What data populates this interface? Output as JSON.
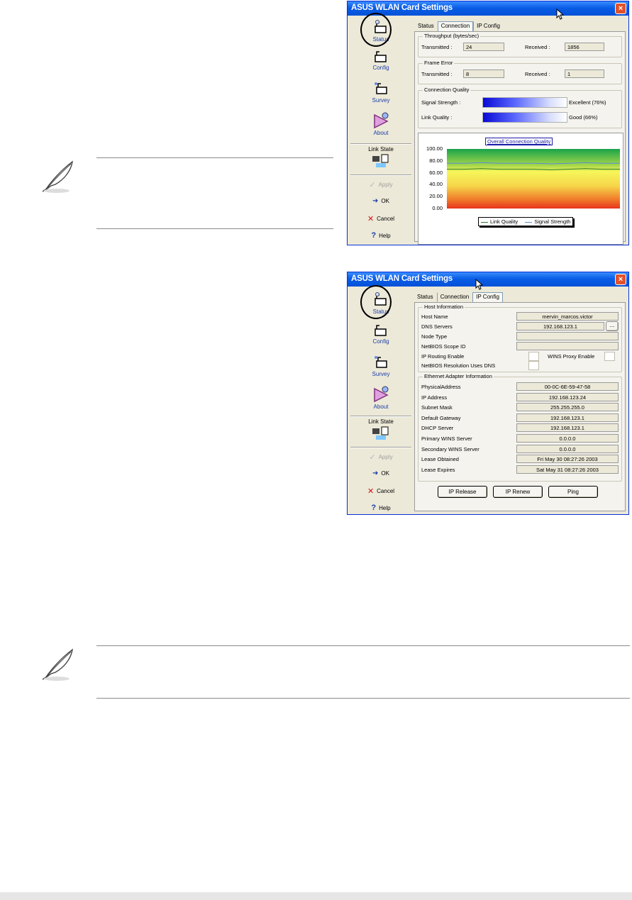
{
  "window_top": {
    "title": "ASUS WLAN Card Settings",
    "close": "×",
    "sidebar": {
      "items": [
        {
          "label": "Status",
          "icon": "status-icon"
        },
        {
          "label": "Config",
          "icon": "config-icon"
        },
        {
          "label": "Survey",
          "icon": "survey-icon"
        },
        {
          "label": "About",
          "icon": "about-icon"
        }
      ],
      "link_state_label": "Link State",
      "actions": [
        {
          "label": "Apply",
          "icon": "checkmark-icon",
          "enabled": false
        },
        {
          "label": "OK",
          "icon": "ok-icon",
          "enabled": true
        },
        {
          "label": "Cancel",
          "icon": "x-icon",
          "enabled": true
        },
        {
          "label": "Help",
          "icon": "question-icon",
          "enabled": true
        }
      ]
    },
    "tabs": [
      {
        "label": "Status",
        "active": false
      },
      {
        "label": "Connection",
        "active": true
      },
      {
        "label": "IP Config",
        "active": false
      }
    ],
    "throughput": {
      "title": "Throughput (bytes/sec)",
      "transmitted_label": "Transmitted :",
      "transmitted_value": "24",
      "received_label": "Received :",
      "received_value": "1856"
    },
    "frame_error": {
      "title": "Frame Error",
      "transmitted_label": "Transmitted :",
      "transmitted_value": "8",
      "received_label": "Received :",
      "received_value": "1"
    },
    "connection_quality": {
      "title": "Connection Quality",
      "signal_label": "Signal Strength :",
      "signal_text": "Excellent (76%)",
      "signal_level": 0.76,
      "link_label": "Link Quality :",
      "link_text": "Good (66%)",
      "link_level": 0.66
    }
  },
  "chart_data": {
    "type": "line",
    "title": "Overall Connection Quality",
    "ylim": [
      0,
      100
    ],
    "yticks": [
      "100.00",
      "80.00",
      "60.00",
      "40.00",
      "20.00",
      "0.00"
    ],
    "series": [
      {
        "name": "Link Quality",
        "color": "#2a7a2a",
        "values": [
          66,
          66,
          67,
          66,
          66,
          66,
          65,
          66,
          67,
          66,
          66
        ]
      },
      {
        "name": "Signal Strength",
        "color": "#5a8ad6",
        "values": [
          76,
          76,
          77,
          76,
          76,
          76,
          75,
          76,
          77,
          76,
          76
        ]
      }
    ],
    "legend_position": "bottom"
  },
  "window_bottom": {
    "title": "ASUS WLAN Card Settings",
    "close": "×",
    "tabs": [
      {
        "label": "Status",
        "active": false
      },
      {
        "label": "Connection",
        "active": false
      },
      {
        "label": "IP Config",
        "active": true
      }
    ],
    "host_info": {
      "title": "Host Information",
      "host_name_label": "Host Name",
      "host_name_value": "mervin_marcos.victor",
      "dns_label": "DNS Servers",
      "dns_value": "192.168.123.1",
      "dns_more": "...",
      "node_type_label": "Node Type",
      "node_type_value": "",
      "netbios_scope_label": "NetBIOS Scope ID",
      "netbios_scope_value": "",
      "ip_routing_label": "IP Routing Enable",
      "wins_proxy_label": "WINS Proxy Enable",
      "netbios_dns_label": "NetBIOS Resolution Uses DNS"
    },
    "adapter_info": {
      "title": "Ethernet Adapter Information",
      "rows": [
        {
          "label": "PhysicalAddress",
          "value": "00-0C-6E-59-47-58"
        },
        {
          "label": "IP Address",
          "value": "192.168.123.24"
        },
        {
          "label": "Subnet Mask",
          "value": "255.255.255.0"
        },
        {
          "label": "Default Gateway",
          "value": "192.168.123.1"
        },
        {
          "label": "DHCP Server",
          "value": "192.168.123.1"
        },
        {
          "label": "Primary WINS Server",
          "value": "0.0.0.0"
        },
        {
          "label": "Secondary WINS Server",
          "value": "0.0.0.0"
        },
        {
          "label": "Lease Obtained",
          "value": "Fri May 30 08:27:26 2003"
        },
        {
          "label": "Lease Expires",
          "value": "Sat May 31 08:27:26 2003"
        }
      ]
    },
    "buttons": {
      "release": "IP Release",
      "renew": "IP Renew",
      "ping": "Ping"
    }
  }
}
